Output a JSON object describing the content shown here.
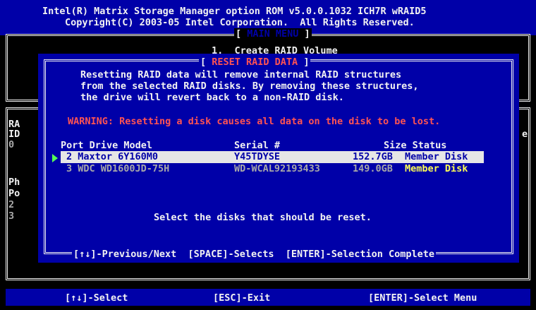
{
  "header": {
    "line1": "Intel(R) Matrix Storage Manager option ROM v5.0.0.1032 ICH7R wRAID5",
    "line2": "Copyright(C) 2003-05 Intel Corporation.  All Rights Reserved."
  },
  "main_menu": {
    "title": "[ MAIN MENU ]",
    "visible_item": "1.  Create RAID Volume"
  },
  "background_panel": {
    "left_fragments": [
      "RA",
      "ID",
      "0",
      "Ph",
      "Po",
      "2",
      "3"
    ],
    "right_fragment": "e"
  },
  "dialog": {
    "title": "[ RESET RAID DATA ]",
    "description": [
      "Resetting RAID data will remove internal RAID structures",
      "from the selected RAID disks. By removing these structures,",
      "the drive will revert back to a non-RAID disk."
    ],
    "warning": "WARNING: Resetting a disk causes all data on the disk to be lost.",
    "columns": {
      "port_model": "Port Drive Model",
      "serial": "Serial #",
      "size_status": "Size Status"
    },
    "disks": [
      {
        "port_model": "2 Maxtor 6Y160M0",
        "serial": "Y45TDYSE",
        "size": "152.7GB",
        "status": "Member Disk",
        "selected": true
      },
      {
        "port_model": "3 WDC WD1600JD-75H",
        "serial": "WD-WCAL92193433",
        "size": "149.0GB",
        "status": "Member Disk",
        "selected": false
      }
    ],
    "instruction": "Select the disks that should be reset.",
    "footer_help": "[↑↓]-Previous/Next  [SPACE]-Selects  [ENTER]-Selection Complete"
  },
  "bottom_bar": {
    "select": "[↑↓]-Select",
    "exit": "[ESC]-Exit",
    "enter": "[ENTER]-Select Menu"
  },
  "colors": {
    "bios_blue": "#0000a8",
    "text_white": "#f2f2f2",
    "warning_red": "#ff5353",
    "status_yellow": "#ffff55",
    "cursor_green": "#55ff55"
  }
}
